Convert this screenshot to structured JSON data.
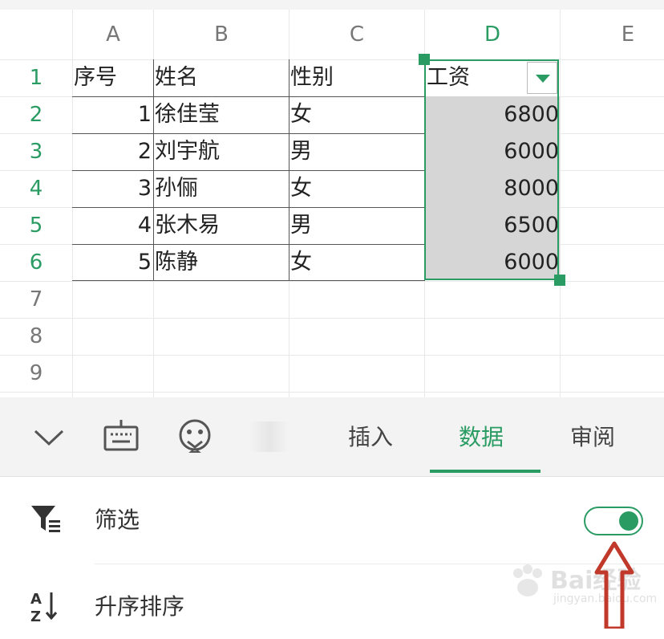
{
  "sheet": {
    "columns": [
      "A",
      "B",
      "C",
      "D",
      "E"
    ],
    "rows": [
      "1",
      "2",
      "3",
      "4",
      "5",
      "6",
      "7",
      "8",
      "9"
    ],
    "header_row": {
      "a": "序号",
      "b": "姓名",
      "c": "性别",
      "d": "工资"
    },
    "data_rows": [
      {
        "a": "1",
        "b": "徐佳莹",
        "c": "女",
        "d": "6800"
      },
      {
        "a": "2",
        "b": "刘宇航",
        "c": "男",
        "d": "6000"
      },
      {
        "a": "3",
        "b": "孙俪",
        "c": "女",
        "d": "8000"
      },
      {
        "a": "4",
        "b": "张木易",
        "c": "男",
        "d": "6500"
      },
      {
        "a": "5",
        "b": "陈静",
        "c": "女",
        "d": "6000"
      }
    ],
    "selected_column": "D"
  },
  "toolbar": {
    "icons": [
      "collapse-chevron-icon",
      "keyboard-icon",
      "emoji-icon"
    ],
    "tabs": [
      {
        "label": "插入",
        "active": false
      },
      {
        "label": "数据",
        "active": true
      },
      {
        "label": "审阅",
        "active": false
      }
    ]
  },
  "panel": {
    "filter_label": "筛选",
    "filter_enabled": true,
    "sort_asc_label": "升序排序"
  },
  "watermark": {
    "brand": "Bai经验",
    "site": "jingyan.baidu.com"
  },
  "colors": {
    "accent": "#2a9c63",
    "selection_fill": "#d6d6d6",
    "annotation_arrow": "#c0392b"
  }
}
